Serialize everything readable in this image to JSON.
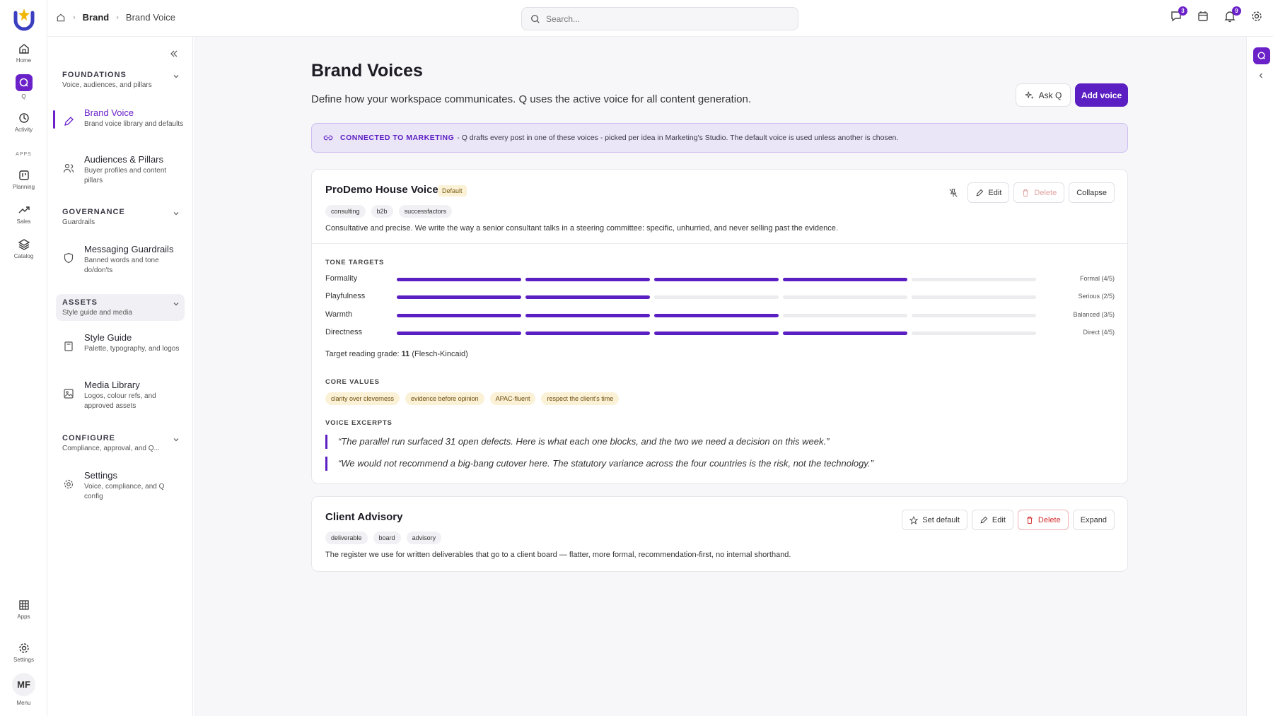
{
  "rail": {
    "items": [
      {
        "label": "Home",
        "icon": "home-icon"
      },
      {
        "label": "Q",
        "icon": "q-icon"
      },
      {
        "label": "Activity",
        "icon": "history-icon"
      },
      {
        "label": "Planning",
        "icon": "board-icon"
      },
      {
        "label": "Sales",
        "icon": "trend-icon"
      },
      {
        "label": "Catalog",
        "icon": "layers-icon"
      },
      {
        "label": "Apps",
        "icon": "grid-icon"
      },
      {
        "label": "Settings",
        "icon": "gear-icon"
      },
      {
        "label": "Menu",
        "icon": "avatar"
      }
    ],
    "apps_section": "APPS",
    "avatar_initials": "MF"
  },
  "breadcrumb": {
    "section": "Brand",
    "current": "Brand Voice"
  },
  "search": {
    "placeholder": "Search..."
  },
  "top_badges": {
    "messages": "3",
    "notifications": "9"
  },
  "subnav": {
    "groups": [
      {
        "title": "FOUNDATIONS",
        "sub": "Voice, audiences, and pillars"
      },
      {
        "title": "GOVERNANCE",
        "sub": "Guardrails"
      },
      {
        "title": "ASSETS",
        "sub": "Style guide and media"
      },
      {
        "title": "CONFIGURE",
        "sub": "Compliance, approval, and Q..."
      }
    ],
    "items": [
      {
        "title": "Brand Voice",
        "desc": "Brand voice library and defaults"
      },
      {
        "title": "Audiences & Pillars",
        "desc": "Buyer profiles and content pillars"
      },
      {
        "title": "Messaging Guardrails",
        "desc": "Banned words and tone do/don'ts"
      },
      {
        "title": "Style Guide",
        "desc": "Palette, typography, and logos"
      },
      {
        "title": "Media Library",
        "desc": "Logos, colour refs, and approved assets"
      },
      {
        "title": "Settings",
        "desc": "Voice, compliance, and Q config"
      }
    ]
  },
  "page": {
    "title": "Brand Voices",
    "subtitle": "Define how your workspace communicates. Q uses the active voice for all content generation.",
    "ask_label": "Ask Q",
    "add_label": "Add voice"
  },
  "banner": {
    "lead": "CONNECTED TO MARKETING",
    "text": "- Q drafts every post in one of these voices - picked per idea in Marketing's Studio. The default voice is used unless another is chosen."
  },
  "voices": [
    {
      "name": "ProDemo House Voice",
      "default_tag": "Default",
      "tags": [
        "consulting",
        "b2b",
        "successfactors"
      ],
      "description": "Consultative and precise. We write the way a senior consultant talks in a steering committee: specific, unhurried, and never selling past the evidence.",
      "actions": {
        "edit": "Edit",
        "delete": "Delete",
        "toggle": "Collapse"
      },
      "tone_label": "TONE TARGETS",
      "tones": [
        {
          "name": "Formality",
          "level": 4,
          "value": "Formal (4/5)"
        },
        {
          "name": "Playfulness",
          "level": 2,
          "value": "Serious (2/5)"
        },
        {
          "name": "Warmth",
          "level": 3,
          "value": "Balanced (3/5)"
        },
        {
          "name": "Directness",
          "level": 4,
          "value": "Direct (4/5)"
        }
      ],
      "reading_prefix": "Target reading grade: ",
      "reading_grade": "11",
      "reading_suffix": " (Flesch-Kincaid)",
      "values_label": "CORE VALUES",
      "values": [
        "clarity over cleverness",
        "evidence before opinion",
        "APAC-fluent",
        "respect the client's time"
      ],
      "excerpts_label": "VOICE EXCERPTS",
      "excerpts": [
        "“The parallel run surfaced 31 open defects. Here is what each one blocks, and the two we need a decision on this week.”",
        "“We would not recommend a big-bang cutover here. The statutory variance across the four countries is the risk, not the technology.”"
      ]
    },
    {
      "name": "Client Advisory",
      "tags": [
        "deliverable",
        "board",
        "advisory"
      ],
      "description": "The register we use for written deliverables that go to a client board — flatter, more formal, recommendation-first, no internal shorthand.",
      "actions": {
        "set_default": "Set default",
        "edit": "Edit",
        "delete": "Delete",
        "toggle": "Expand"
      }
    }
  ],
  "colors": {
    "accent": "#5b1ec2",
    "banner_bg": "#ebe5f8",
    "tag_amber": "#fbf1d7",
    "danger": "#d32f2f"
  }
}
